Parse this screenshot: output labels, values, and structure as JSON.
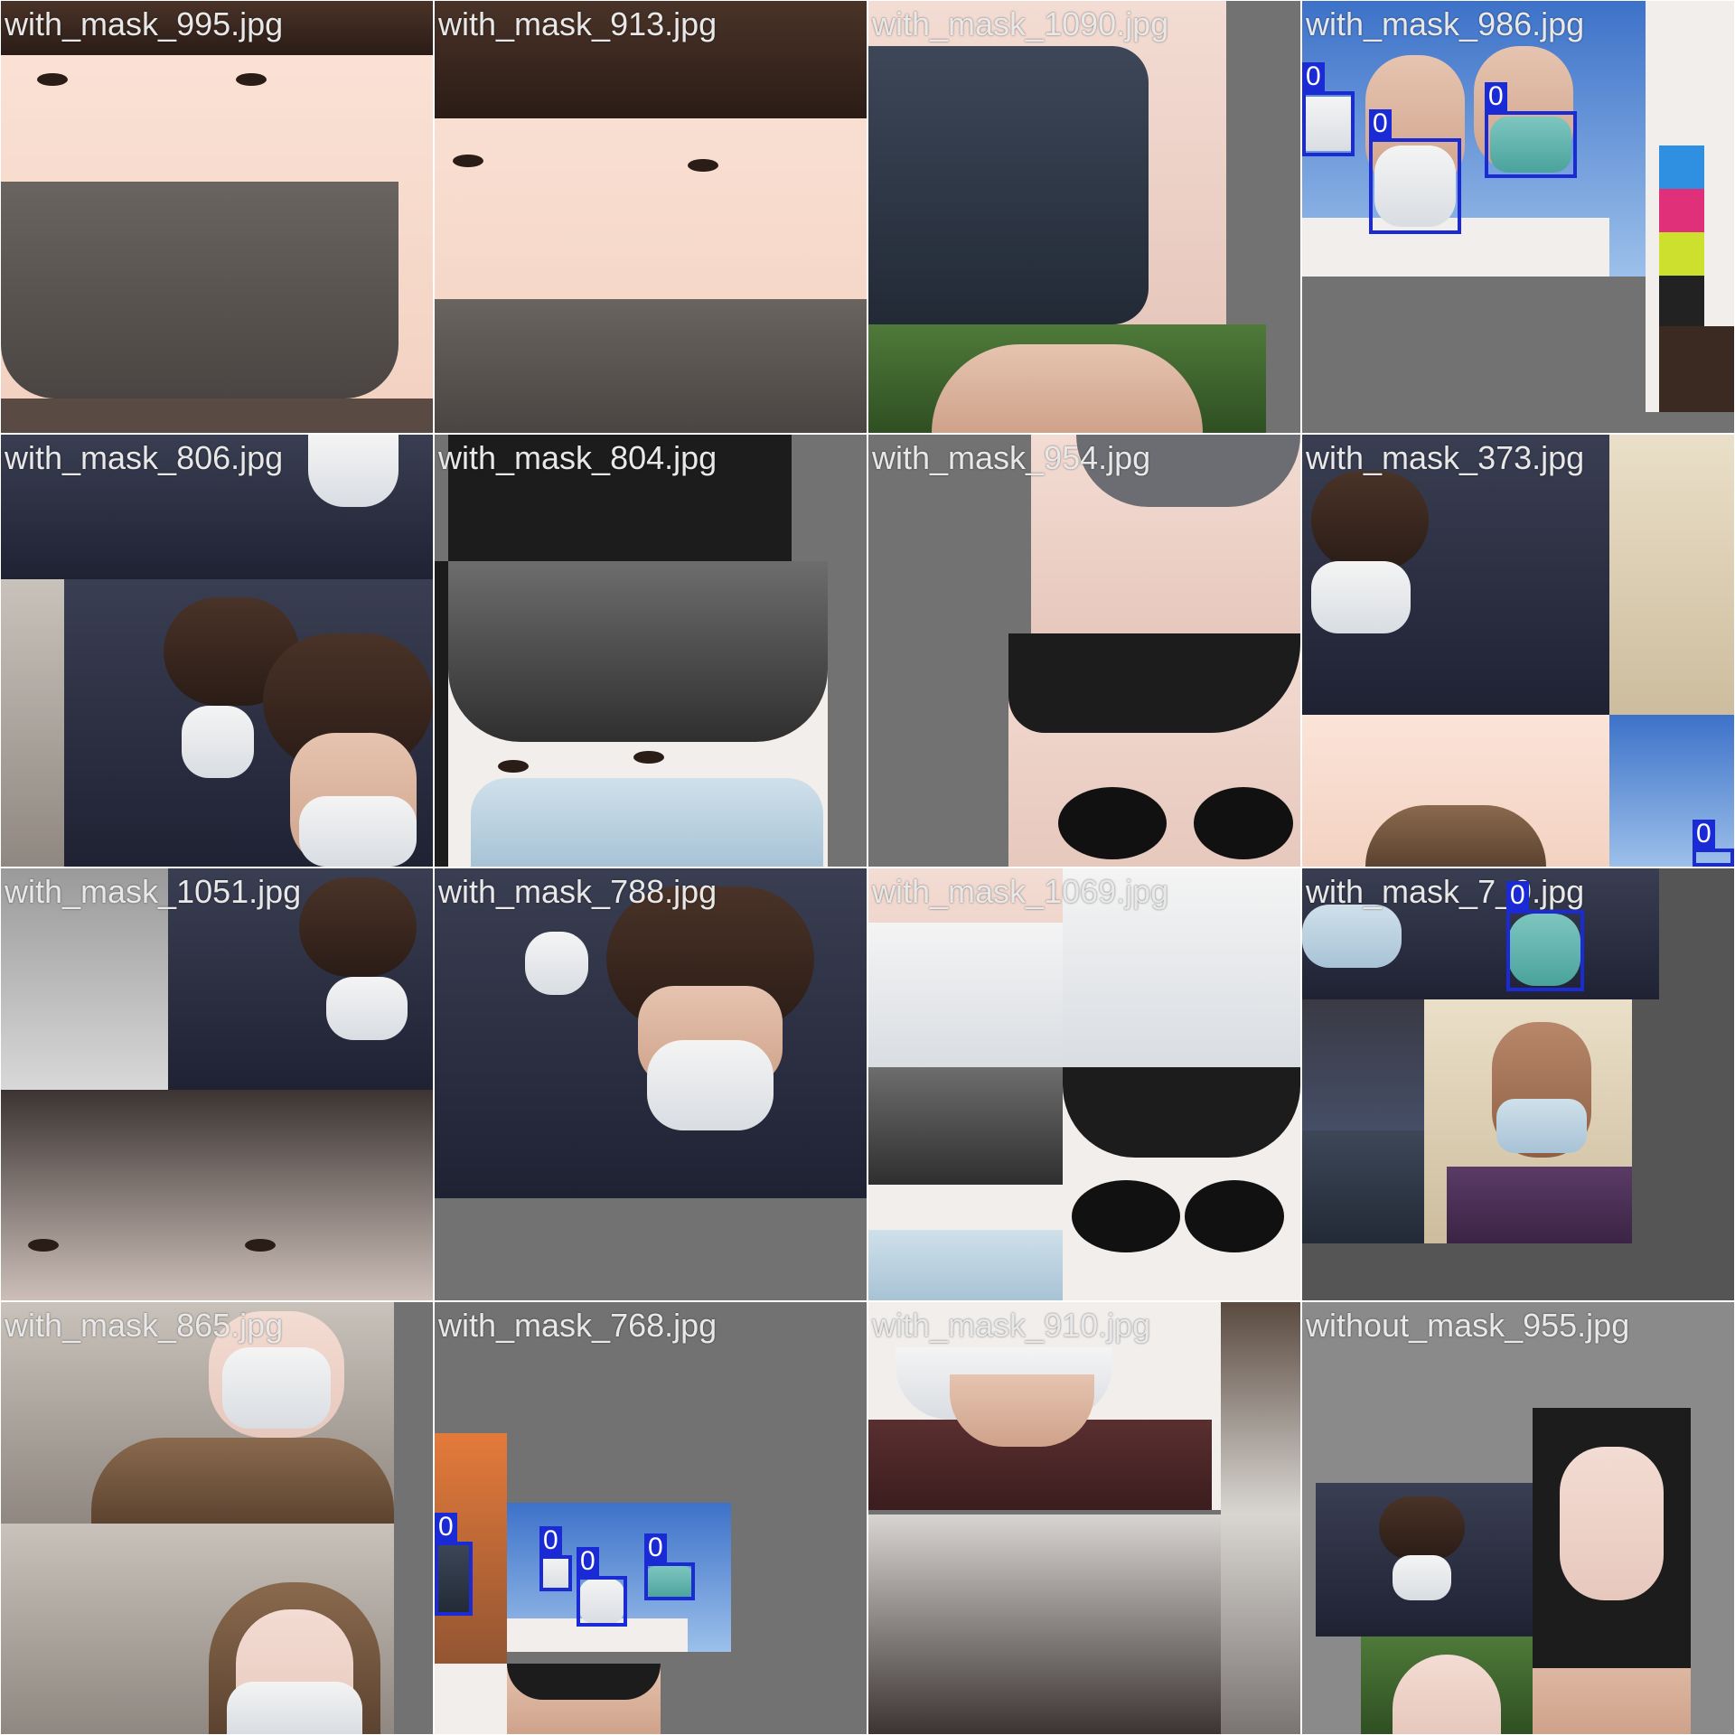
{
  "mosaic": {
    "tiles": [
      {
        "label": "with_mask_995.jpg",
        "detections": []
      },
      {
        "label": "with_mask_913.jpg",
        "detections": []
      },
      {
        "label": "with_mask_1090.jpg",
        "detections": []
      },
      {
        "label": "with_mask_986.jpg",
        "detections": [
          "0",
          "0",
          "0"
        ]
      },
      {
        "label": "with_mask_806.jpg",
        "detections": []
      },
      {
        "label": "with_mask_804.jpg",
        "detections": []
      },
      {
        "label": "with_mask_954.jpg",
        "detections": []
      },
      {
        "label": "with_mask_373.jpg",
        "detections": [
          "0"
        ]
      },
      {
        "label": "with_mask_1051.jpg",
        "detections": []
      },
      {
        "label": "with_mask_788.jpg",
        "detections": []
      },
      {
        "label": "with_mask_1069.jpg",
        "detections": []
      },
      {
        "label": "with_mask_7_9.jpg",
        "detections": [
          "0"
        ]
      },
      {
        "label": "with_mask_865.jpg",
        "detections": []
      },
      {
        "label": "with_mask_768.jpg",
        "detections": [
          "0",
          "0",
          "0",
          "0"
        ]
      },
      {
        "label": "with_mask_910.jpg",
        "detections": []
      },
      {
        "label": "without_mask_955.jpg",
        "detections": []
      }
    ]
  },
  "colors": {
    "box": "#1a2bd6",
    "label_text": "#e8e8e8",
    "padding_grey": "#727272"
  }
}
